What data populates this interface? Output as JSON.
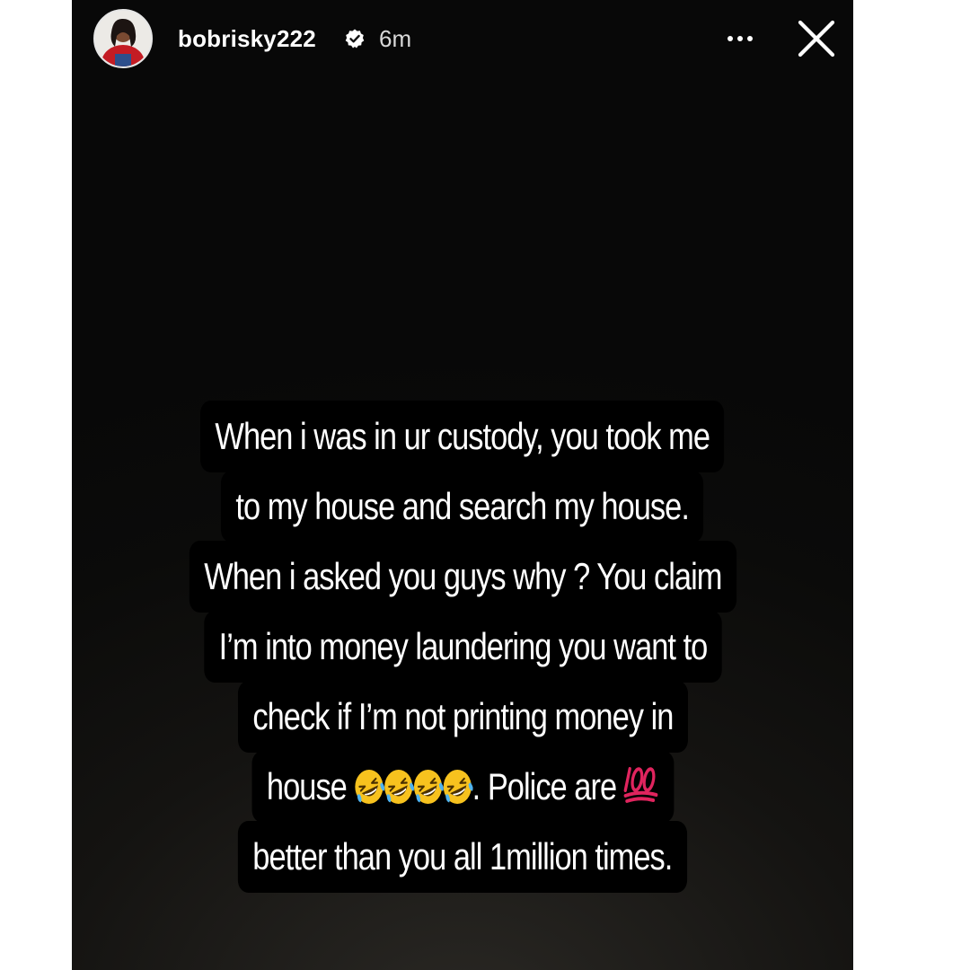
{
  "story": {
    "username": "bobrisky222",
    "timestamp": "6m",
    "more_label": "•••",
    "close_label": "✕",
    "icons": {
      "verified": "verified-badge-icon",
      "more": "more-options-icon",
      "close": "close-icon"
    }
  },
  "caption": {
    "lines": [
      "When i was in ur custody, you took me",
      "to my house and search my house.",
      "When i asked you guys why ? You claim",
      "I’m into money laundering you want to",
      "check if I’m not printing money in",
      "house",
      ". Police are",
      "better than you all 1million times."
    ],
    "emojis": [
      "rofl-emoji",
      "rofl-emoji",
      "rofl-emoji",
      "rofl-emoji",
      "hundred-points-emoji"
    ]
  },
  "colors": {
    "text": "#ffffff",
    "caption_bg": "#000000",
    "story_bg": "#0b0b0a",
    "page_bg": "#ffffff",
    "hundred": "#e0245e",
    "emoji_face": "#f7c21e"
  }
}
